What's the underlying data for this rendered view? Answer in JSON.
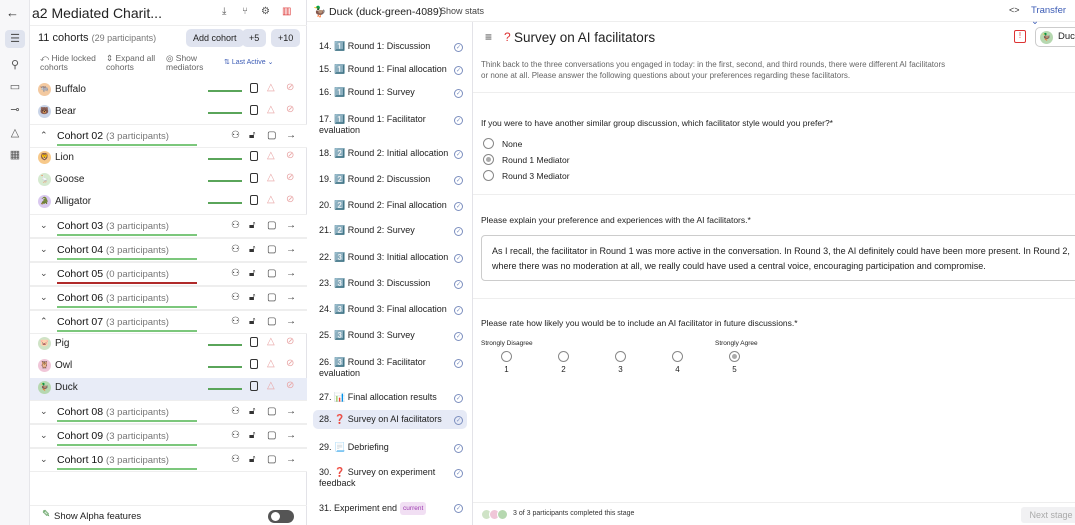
{
  "experiment": {
    "title": "a2 Mediated Charit...",
    "back_icon": "arrow-left-icon"
  },
  "cohort_bar": {
    "count_label": "11 cohorts",
    "participants_label": "(29 participants)",
    "add_cohort": "Add cohort",
    "plus5": "+5",
    "plus10": "+10"
  },
  "filters": {
    "hide_locked": "Hide locked cohorts",
    "expand_all": "Expand all cohorts",
    "show_mediators": "Show mediators",
    "sort": "Last Active"
  },
  "rows": [
    {
      "kind": "participant",
      "name": "Buffalo",
      "emoji": "🐃",
      "color": "#f3c9a0"
    },
    {
      "kind": "participant",
      "name": "Bear",
      "emoji": "🐻",
      "color": "#c9d4e8"
    },
    {
      "kind": "cohort",
      "name": "Cohort 02",
      "count": "(3 participants)",
      "open": true,
      "line": "green"
    },
    {
      "kind": "participant",
      "name": "Lion",
      "emoji": "🦁",
      "color": "#f7c98a"
    },
    {
      "kind": "participant",
      "name": "Goose",
      "emoji": "🪿",
      "color": "#d6ead0"
    },
    {
      "kind": "participant",
      "name": "Alligator",
      "emoji": "🐊",
      "color": "#d9c8ef"
    },
    {
      "kind": "cohort",
      "name": "Cohort 03",
      "count": "(3 participants)",
      "open": false,
      "line": "green"
    },
    {
      "kind": "cohort",
      "name": "Cohort 04",
      "count": "(3 participants)",
      "open": false,
      "line": "green"
    },
    {
      "kind": "cohort",
      "name": "Cohort 05",
      "count": "(0 participants)",
      "open": false,
      "line": "red"
    },
    {
      "kind": "cohort",
      "name": "Cohort 06",
      "count": "(3 participants)",
      "open": false,
      "line": "green"
    },
    {
      "kind": "cohort",
      "name": "Cohort 07",
      "count": "(3 participants)",
      "open": true,
      "line": "green"
    },
    {
      "kind": "participant",
      "name": "Pig",
      "emoji": "🐷",
      "color": "#cfe3c6"
    },
    {
      "kind": "participant",
      "name": "Owl",
      "emoji": "🦉",
      "color": "#f0c6d8"
    },
    {
      "kind": "participant",
      "name": "Duck",
      "emoji": "🦆",
      "color": "#b6d8b0",
      "selected": true
    },
    {
      "kind": "cohort",
      "name": "Cohort 08",
      "count": "(3 participants)",
      "open": false,
      "line": "green"
    },
    {
      "kind": "cohort",
      "name": "Cohort 09",
      "count": "(3 participants)",
      "open": false,
      "line": "green"
    },
    {
      "kind": "cohort",
      "name": "Cohort 10",
      "count": "(3 participants)",
      "open": false,
      "line": "green"
    }
  ],
  "alpha": {
    "label": "Show Alpha features"
  },
  "topbar": {
    "participant": "Duck (duck-green-4089)",
    "show_stats": "Show stats",
    "code": "<>",
    "transfer": "Transfer ⌄"
  },
  "stages": [
    {
      "label": "14. 1️⃣ Round 1: Discussion",
      "n": "1"
    },
    {
      "label": "15. 1️⃣ Round 1: Final allocation",
      "n": "1"
    },
    {
      "label": "16. 1️⃣ Round 1: Survey",
      "n": "1"
    },
    {
      "label": "17. 1️⃣ Round 1: Facilitator evaluation",
      "n": "1"
    },
    {
      "label": "18. 2️⃣ Round 2: Initial allocation",
      "n": "2"
    },
    {
      "label": "19. 2️⃣ Round 2: Discussion",
      "n": "2"
    },
    {
      "label": "20. 2️⃣ Round 2: Final allocation",
      "n": "2"
    },
    {
      "label": "21. 2️⃣ Round 2: Survey",
      "n": "2"
    },
    {
      "label": "22. 3️⃣ Round 3: Initial allocation",
      "n": "3"
    },
    {
      "label": "23. 3️⃣ Round 3: Discussion",
      "n": "3"
    },
    {
      "label": "24. 3️⃣ Round 3: Final allocation",
      "n": "3"
    },
    {
      "label": "25. 3️⃣ Round 3: Survey",
      "n": "3"
    },
    {
      "label": "26. 3️⃣ Round 3: Facilitator evaluation",
      "n": "3"
    },
    {
      "label": "27. 📊 Final allocation results",
      "n": ""
    },
    {
      "label": "28. ❓ Survey on AI facilitators",
      "n": "",
      "selected": true
    },
    {
      "label": "29. 📃 Debriefing",
      "n": ""
    },
    {
      "label": "30. ❓ Survey on experiment feedback",
      "n": ""
    },
    {
      "label": "31. Experiment end",
      "n": "",
      "badge": "current"
    }
  ],
  "main": {
    "title": "Survey on AI facilitators",
    "user": "Duck",
    "description": "Think back to the three conversations you engaged in today: in the first, second, and third rounds, there were different AI facilitators or none at all. Please answer the following questions about your preferences regarding these facilitators.",
    "q1": "If you were to have another similar group discussion, which facilitator style would you prefer?*",
    "q1_options": [
      "None",
      "Round 1 Mediator",
      "Round 3 Mediator"
    ],
    "q2": "Please explain your preference and experiences with the AI facilitators.*",
    "q2_answer": "As I recall, the facilitator in Round 1 was more active in the conversation. In Round 3, the AI definitely could have been more present. In Round 2, where there was no moderation at all, we really could have used a central voice, encouraging participation and compromise.",
    "q3": "Please rate how likely you would be to include an AI facilitator in future discussions.*",
    "q3_low": "Strongly Disagree",
    "q3_high": "Strongly Agree",
    "q3_scale": [
      "1",
      "2",
      "3",
      "4",
      "5"
    ],
    "q3_selected": "5",
    "completed": "3 of 3 participants completed this stage",
    "next": "Next stage"
  }
}
